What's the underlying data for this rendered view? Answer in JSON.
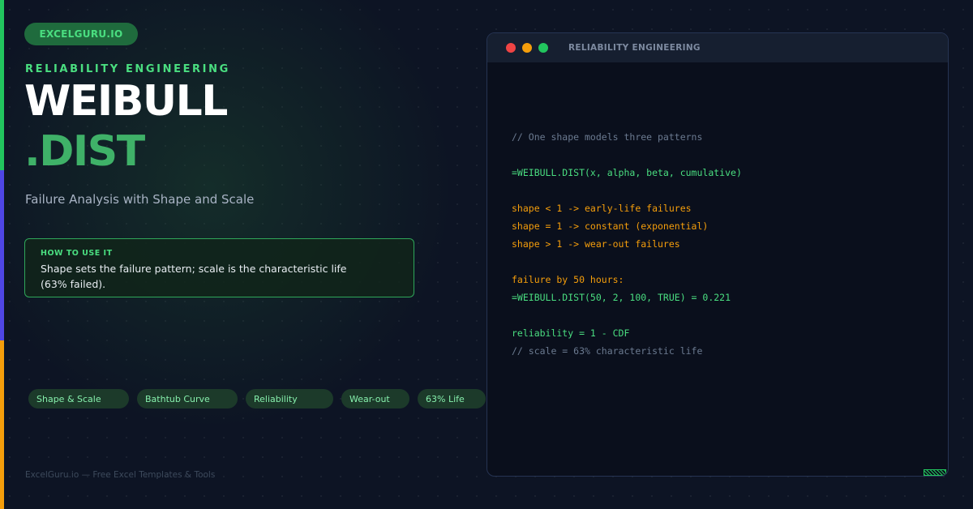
{
  "brand": {
    "pill_label": "EXCELGURU.IO"
  },
  "hero": {
    "eyebrow": "RELIABILITY ENGINEERING",
    "title_line1": "WEIBULL",
    "title_line2": ".DIST",
    "subtitle": "Failure Analysis with Shape and Scale"
  },
  "how_to": {
    "label": "HOW TO USE IT",
    "text": "Shape sets the failure pattern; scale is the characteristic life (63% failed)."
  },
  "tags": [
    "Shape & Scale",
    "Bathtub Curve",
    "Reliability",
    "Wear-out",
    "63% Life"
  ],
  "footer": "ExcelGuru.io — Free Excel Templates & Tools",
  "code_window": {
    "title": "RELIABILITY ENGINEERING",
    "lines": [
      "// One shape models three patterns",
      "=WEIBULL.DIST(x, alpha, beta, cumulative)",
      "shape < 1 -> early-life failures",
      "shape = 1 -> constant (exponential)",
      "shape > 1 -> wear-out failures",
      "failure by 50 hours:",
      "=WEIBULL.DIST(50, 2, 100, TRUE) = 0.221",
      "reliability = 1 - CDF",
      "// scale = 63% characteristic life"
    ]
  },
  "colors": {
    "background": "#0d1424",
    "accent_green": "#22c55e",
    "accent_blue": "#4f46e5",
    "accent_orange": "#f59e0b",
    "title_accent": "#3fb168"
  }
}
